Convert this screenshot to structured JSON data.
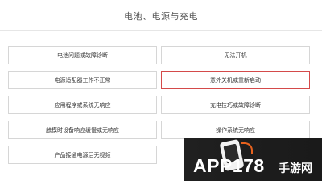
{
  "page": {
    "title": "电池、电源与充电"
  },
  "options": [
    {
      "label": "电池问题或故障诊断"
    },
    {
      "label": "无法开机"
    },
    {
      "label": "电源适配器工作不正常"
    },
    {
      "label": "意外关机或重新启动"
    },
    {
      "label": "应用程序或系统无响应"
    },
    {
      "label": "充电技巧或故障诊断"
    },
    {
      "label": "触摸时设备响应缓慢或无响应"
    },
    {
      "label": "操作系统无响应"
    },
    {
      "label": "产品接通电源后无视频"
    }
  ],
  "selected_label": "意外关机或重新启动",
  "watermark": {
    "text_main": "APP178",
    "text_cn": "手游网"
  },
  "colors": {
    "selected_border": "#d44a4a",
    "border": "#d6d6d6",
    "watermark_accent": "#e7621e"
  }
}
